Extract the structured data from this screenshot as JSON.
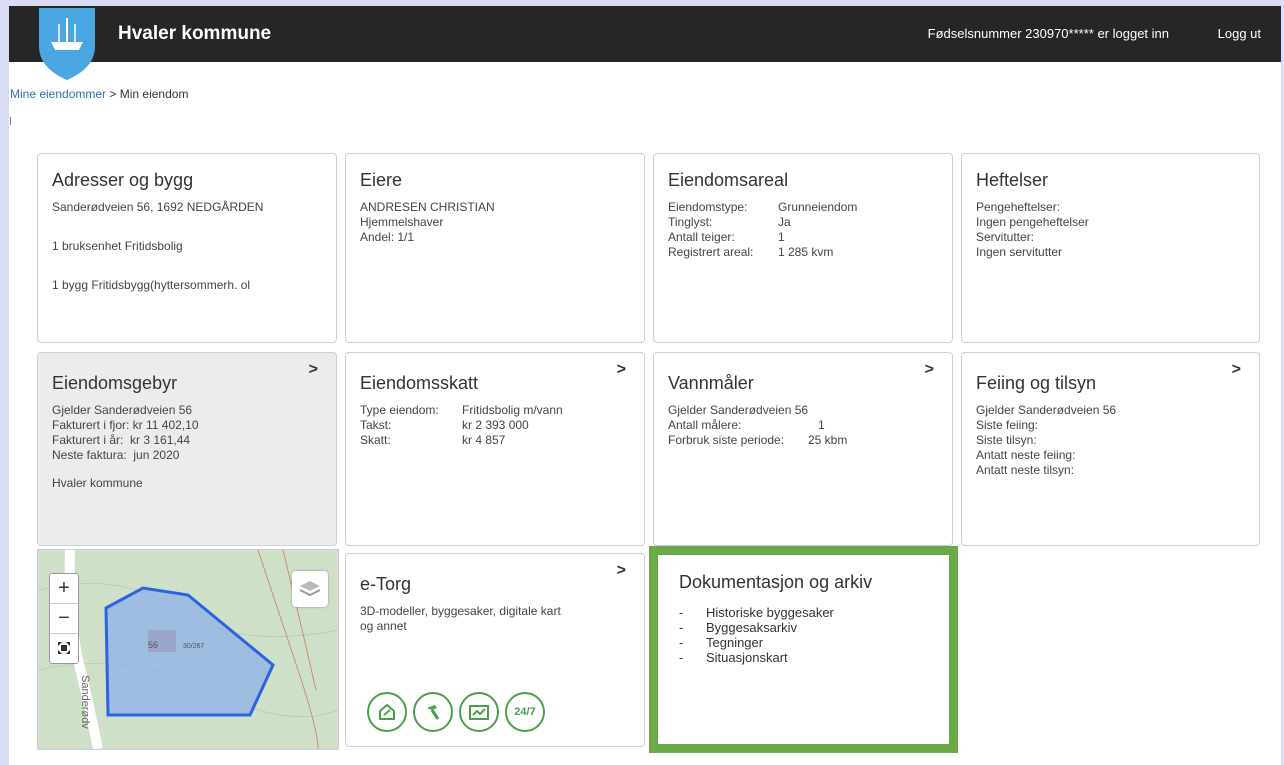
{
  "header": {
    "title": "Hvaler kommune",
    "login_info": "Fødselsnummer 230970***** er logget inn",
    "logout": "Logg ut"
  },
  "breadcrumb": {
    "link": "Mine eiendommer",
    "sep": " > ",
    "current": "Min eiendom"
  },
  "cards": {
    "adresser": {
      "title": "Adresser og bygg",
      "lines": [
        "Sanderødveien 56, 1692 NEDGÅRDEN",
        "1 bruksenhet Fritidsbolig",
        "1 bygg Fritidsbygg(hyttersommerh. ol"
      ]
    },
    "eiere": {
      "title": "Eiere",
      "lines": [
        "ANDRESEN CHRISTIAN",
        "Hjemmelshaver",
        "Andel: 1/1"
      ]
    },
    "areal": {
      "title": "Eiendomsareal",
      "rows": [
        {
          "k": "Eiendomstype:",
          "v": "Grunneiendom"
        },
        {
          "k": "Tinglyst:",
          "v": "Ja"
        },
        {
          "k": "Antall teiger:",
          "v": "1"
        },
        {
          "k": "Registrert areal:",
          "v": "1 285 kvm"
        }
      ]
    },
    "heftelser": {
      "title": "Heftelser",
      "lines": [
        "Pengeheftelser:",
        "Ingen pengeheftelser",
        "Servitutter:",
        "Ingen servitutter"
      ]
    },
    "gebyr": {
      "title": "Eiendomsgebyr",
      "lines": [
        "Gjelder Sanderødveien 56",
        "Fakturert i fjor: kr 11 402,10",
        "Fakturert i år:  kr 3 161,44",
        "Neste faktura:  jun 2020"
      ],
      "footer": "Hvaler kommune"
    },
    "skatt": {
      "title": "Eiendomsskatt",
      "rows": [
        {
          "k": "Type eiendom:",
          "v": "Fritidsbolig m/vann"
        },
        {
          "k": "Takst:",
          "v": "kr 2 393 000"
        },
        {
          "k": "Skatt:",
          "v": "kr 4 857"
        }
      ]
    },
    "vann": {
      "title": "Vannmåler",
      "lines": [
        "Gjelder Sanderødveien 56"
      ],
      "rows": [
        {
          "k": "Antall målere:",
          "v": "1"
        },
        {
          "k": "Forbruk siste periode:",
          "v": "25 kbm"
        }
      ]
    },
    "feiing": {
      "title": "Feiing og tilsyn",
      "lines": [
        "Gjelder Sanderødveien 56",
        "Siste feiing:",
        "Siste tilsyn:",
        "Antatt neste feiing:",
        "Antatt neste tilsyn:"
      ]
    },
    "etorg": {
      "title": "e-Torg",
      "lines": [
        "3D-modeller, byggesaker, digitale kart",
        "og annet"
      ],
      "icon_247": "24/7"
    }
  },
  "map": {
    "zoom_in": "+",
    "zoom_out": "−",
    "parcel_label": "56",
    "parcel_id": "30/267",
    "road_label": "Sanderødv"
  },
  "docs": {
    "title": "Dokumentasjon og arkiv",
    "items": [
      "Historiske byggesaker",
      "Byggesaksarkiv",
      "Tegninger",
      "Situasjonskart"
    ]
  },
  "chevron": ">",
  "dash": "-",
  "colors": {
    "header_bg": "#262626",
    "accent_green": "#6aaa47",
    "link": "#2f6fb5",
    "map_parcel": "#5b8fe8"
  }
}
